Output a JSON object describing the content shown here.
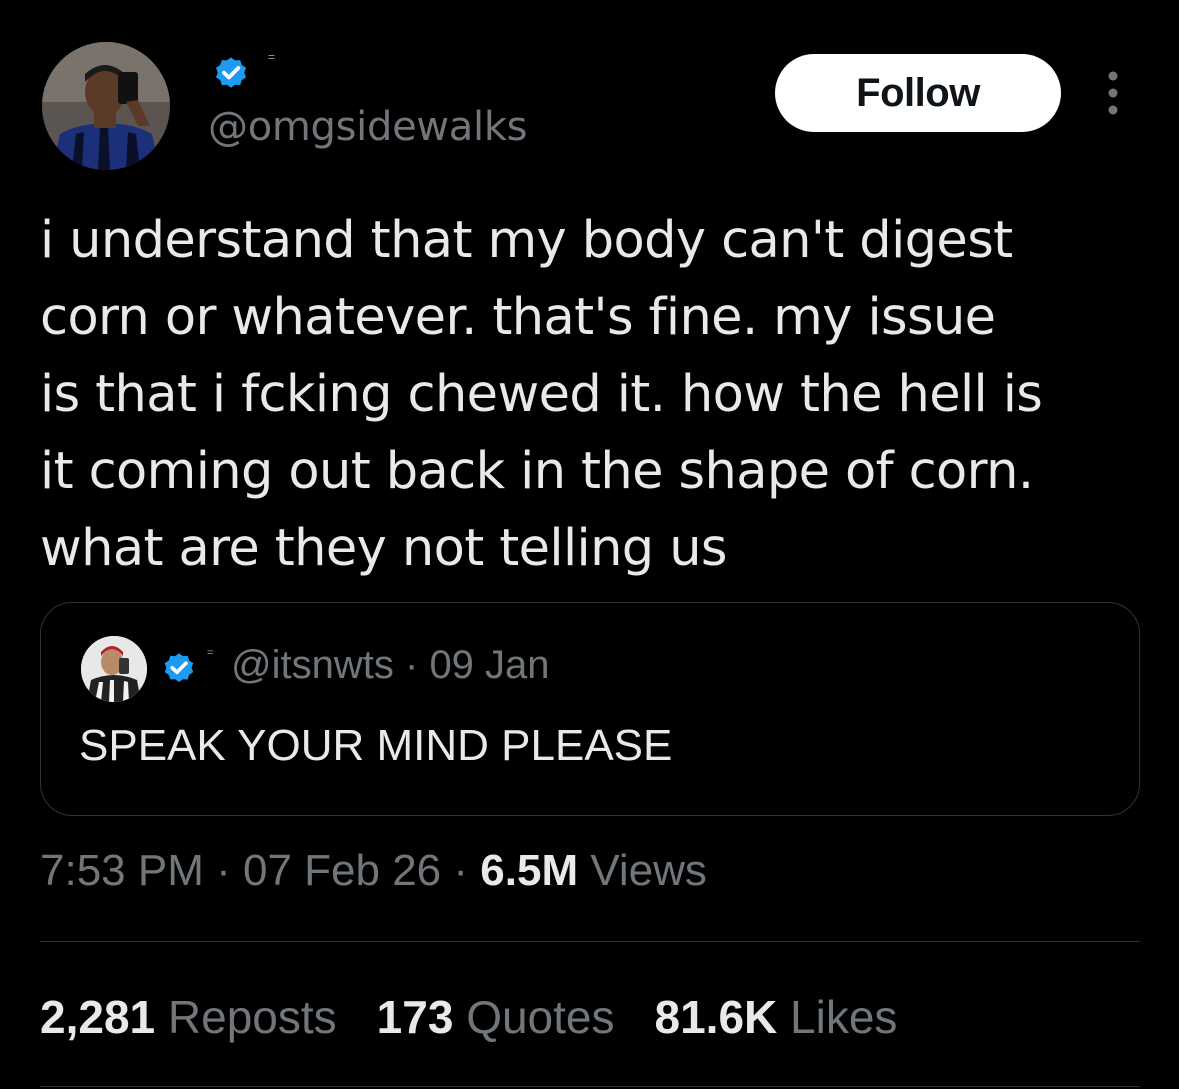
{
  "author": {
    "handle": "@omgsidewalks",
    "name_flag": "=",
    "verified": true,
    "avatar_icon": "profile-photo"
  },
  "follow_label": "Follow",
  "more_icon": "more-vertical-icon",
  "tweet": {
    "text": "i understand that my body can't digest\ncorn or whatever. that's fine. my issue\nis that i fcking chewed it. how the hell is\nit coming out back in the shape of corn.\nwhat are they not telling us"
  },
  "quote": {
    "name_flag": "=",
    "handle": "@itsnwts",
    "separator": "·",
    "date": "09 Jan",
    "text": "SPEAK YOUR MIND PLEASE",
    "verified": true
  },
  "meta": {
    "time": "7:53 PM",
    "separator": "·",
    "date": "07 Feb 26",
    "views_count": "6.5M",
    "views_label": "Views"
  },
  "stats": {
    "reposts_count": "2,281",
    "reposts_label": "Reposts",
    "quotes_count": "173",
    "quotes_label": "Quotes",
    "likes_count": "81.6K",
    "likes_label": "Likes"
  },
  "colors": {
    "background": "#000000",
    "text_primary": "#e7e9ea",
    "text_secondary": "#71767b",
    "border": "#2f3336",
    "verified_blue": "#1d9bf0",
    "follow_bg": "#ffffff"
  }
}
